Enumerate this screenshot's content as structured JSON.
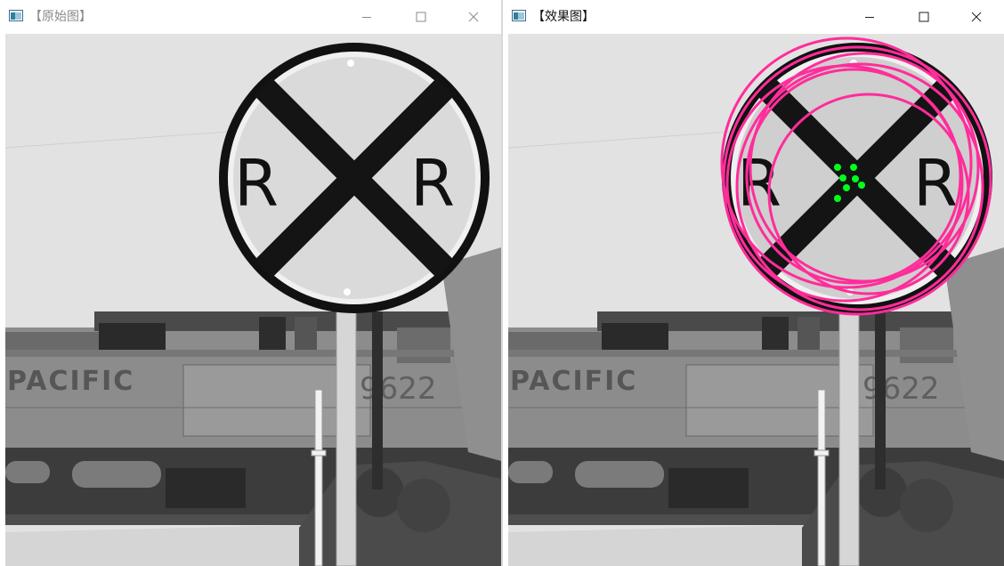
{
  "windows": [
    {
      "title": "【原始图】",
      "state": "inactive"
    },
    {
      "title": "【效果图】",
      "state": "active"
    }
  ],
  "controls": {
    "minimize": "minimize-icon",
    "maximize": "maximize-icon",
    "close": "close-icon"
  },
  "scene": {
    "sign_letter_left": "R",
    "sign_letter_right": "R",
    "train_text": "PACIFIC",
    "train_number": "9622"
  },
  "overlay": {
    "circle_color": "#ff2d9a",
    "center_color": "#00ff1a",
    "circle_count": 7,
    "center_count": 7
  }
}
